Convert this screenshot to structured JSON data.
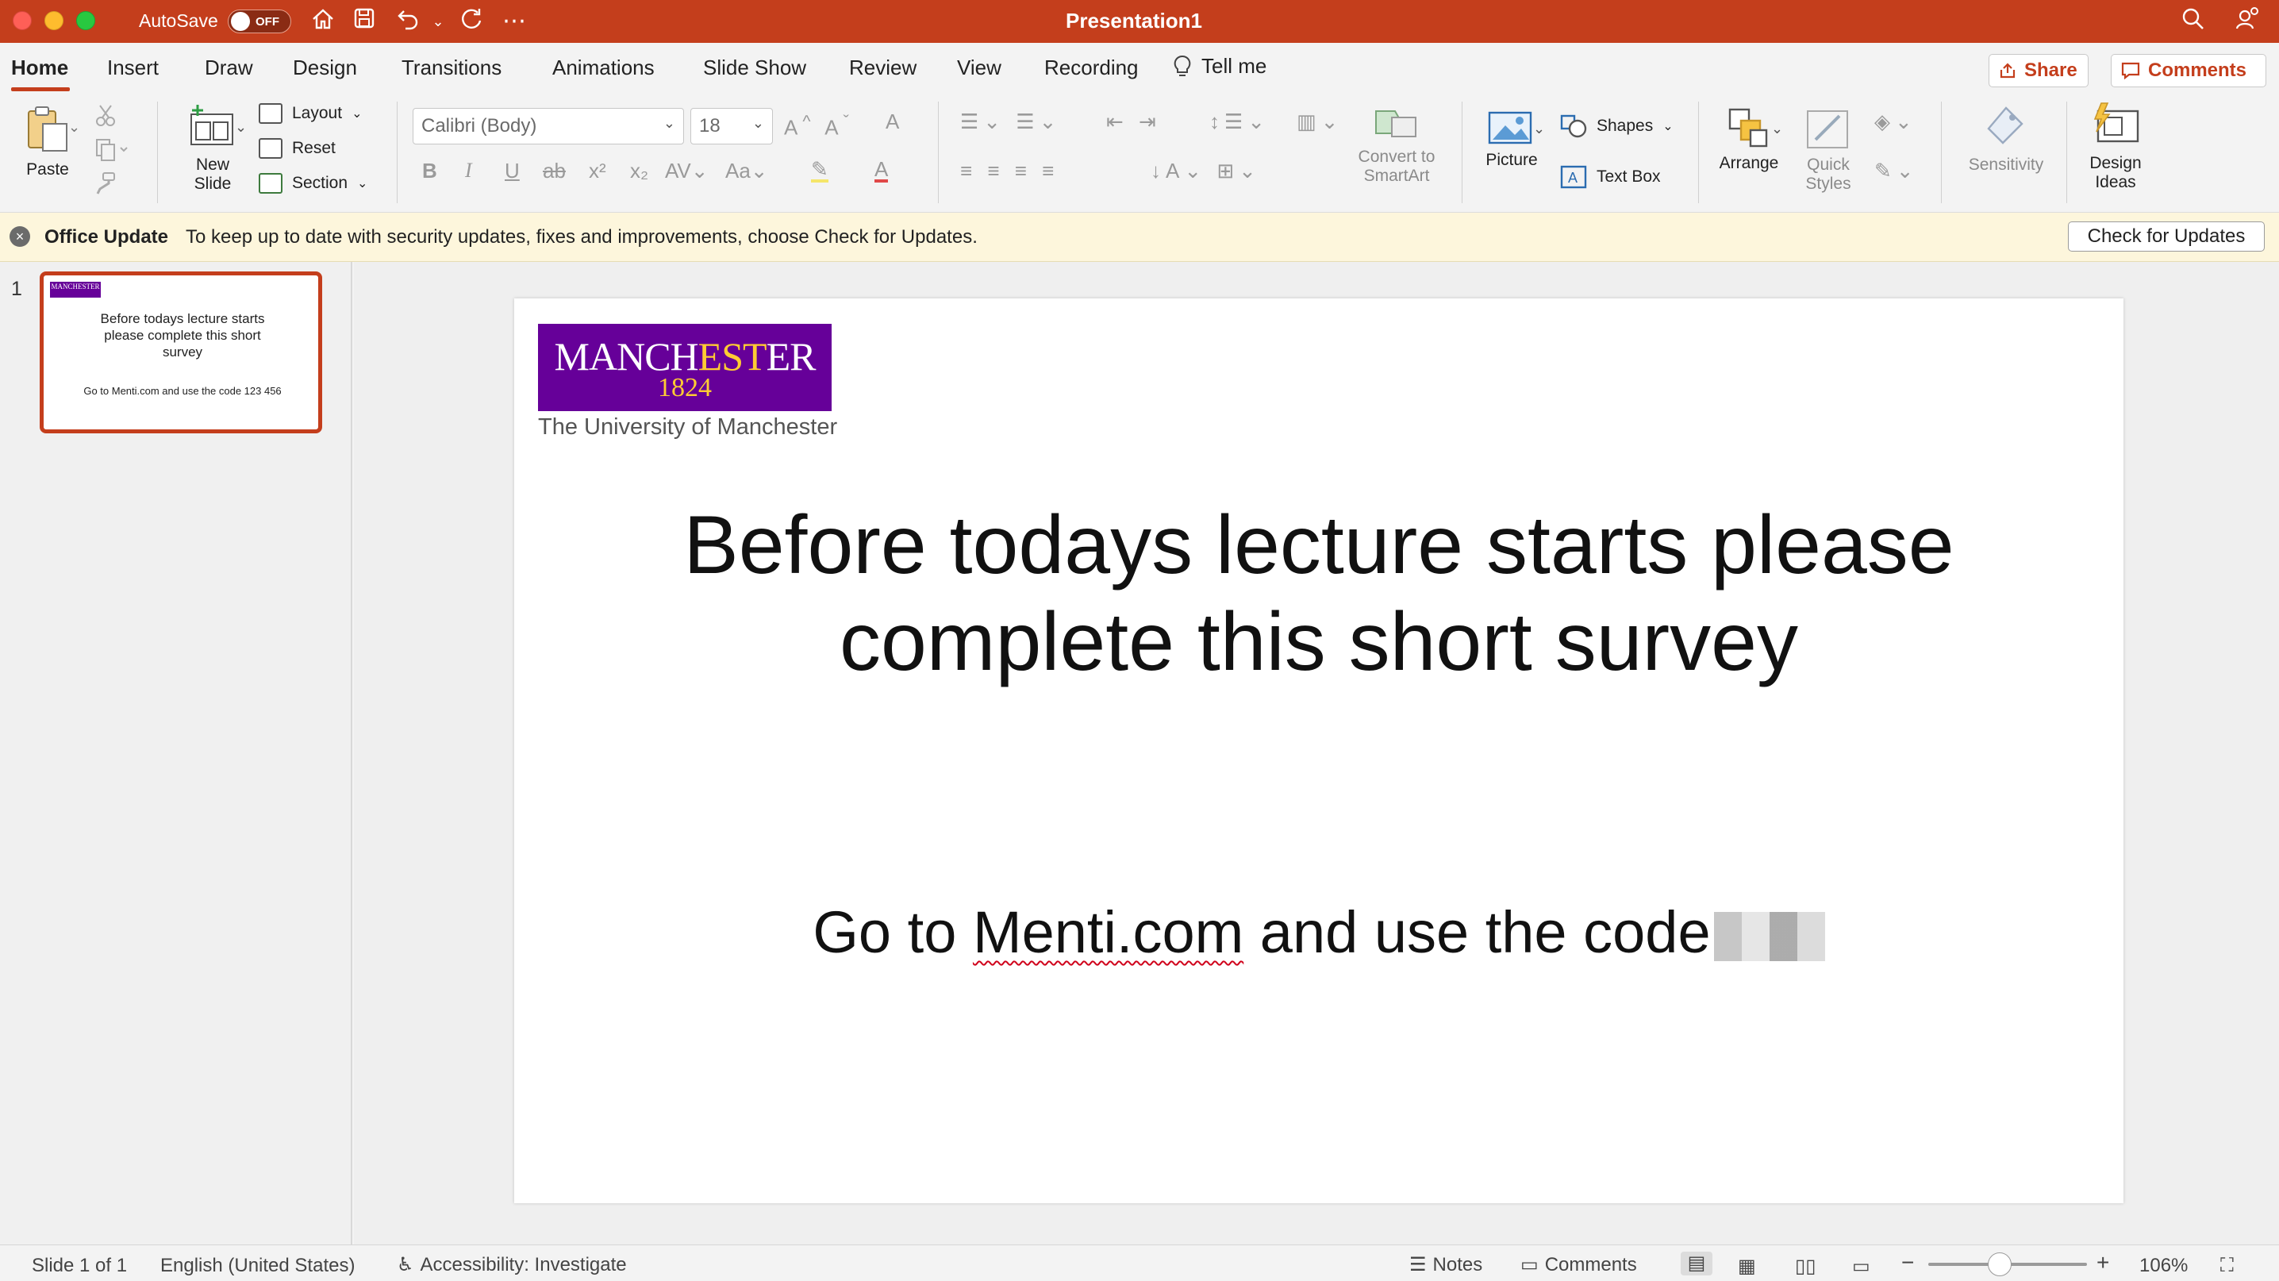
{
  "titlebar": {
    "autosave_label": "AutoSave",
    "autosave_state": "OFF",
    "title": "Presentation1",
    "accent_color": "#c43e1c"
  },
  "tabs": [
    {
      "label": "Home",
      "active": true
    },
    {
      "label": "Insert"
    },
    {
      "label": "Draw"
    },
    {
      "label": "Design"
    },
    {
      "label": "Transitions"
    },
    {
      "label": "Animations"
    },
    {
      "label": "Slide Show"
    },
    {
      "label": "Review"
    },
    {
      "label": "View"
    },
    {
      "label": "Recording"
    },
    {
      "label": "Tell me"
    }
  ],
  "top_buttons": {
    "share": "Share",
    "comments": "Comments"
  },
  "ribbon": {
    "paste": "Paste",
    "new_slide": [
      "New",
      "Slide"
    ],
    "layout": "Layout",
    "reset": "Reset",
    "section": "Section",
    "font_name": "Calibri (Body)",
    "font_size": "18",
    "convert_smartart": [
      "Convert to",
      "SmartArt"
    ],
    "picture": "Picture",
    "shapes": "Shapes",
    "text_box": "Text Box",
    "arrange": "Arrange",
    "quick_styles": [
      "Quick",
      "Styles"
    ],
    "sensitivity": "Sensitivity",
    "design_ideas": [
      "Design",
      "Ideas"
    ]
  },
  "update_bar": {
    "title": "Office Update",
    "message": "To keep up to date with security updates, fixes and improvements, choose Check for Updates.",
    "button": "Check for Updates"
  },
  "thumbnails": [
    {
      "number": "1",
      "logo": "MANCHESTER",
      "title": "Before todays lecture starts please complete this short survey",
      "subtitle": "Go to Menti.com and use the code 123 456"
    }
  ],
  "slide": {
    "logo_name_pre": "MANCH",
    "logo_name_est": "EST",
    "logo_name_post": "ER",
    "logo_year": "1824",
    "logo_university": "The University of Manchester",
    "title": "Before todays lecture starts please complete this short survey",
    "subtitle_pre": "Go to ",
    "subtitle_link": "Menti.com",
    "subtitle_post": " and use the code"
  },
  "status": {
    "slide_indicator": "Slide 1 of 1",
    "language": "English (United States)",
    "accessibility": "Accessibility: Investigate",
    "notes": "Notes",
    "comments": "Comments",
    "zoom": "106%",
    "zoom_fraction": 0.45
  }
}
